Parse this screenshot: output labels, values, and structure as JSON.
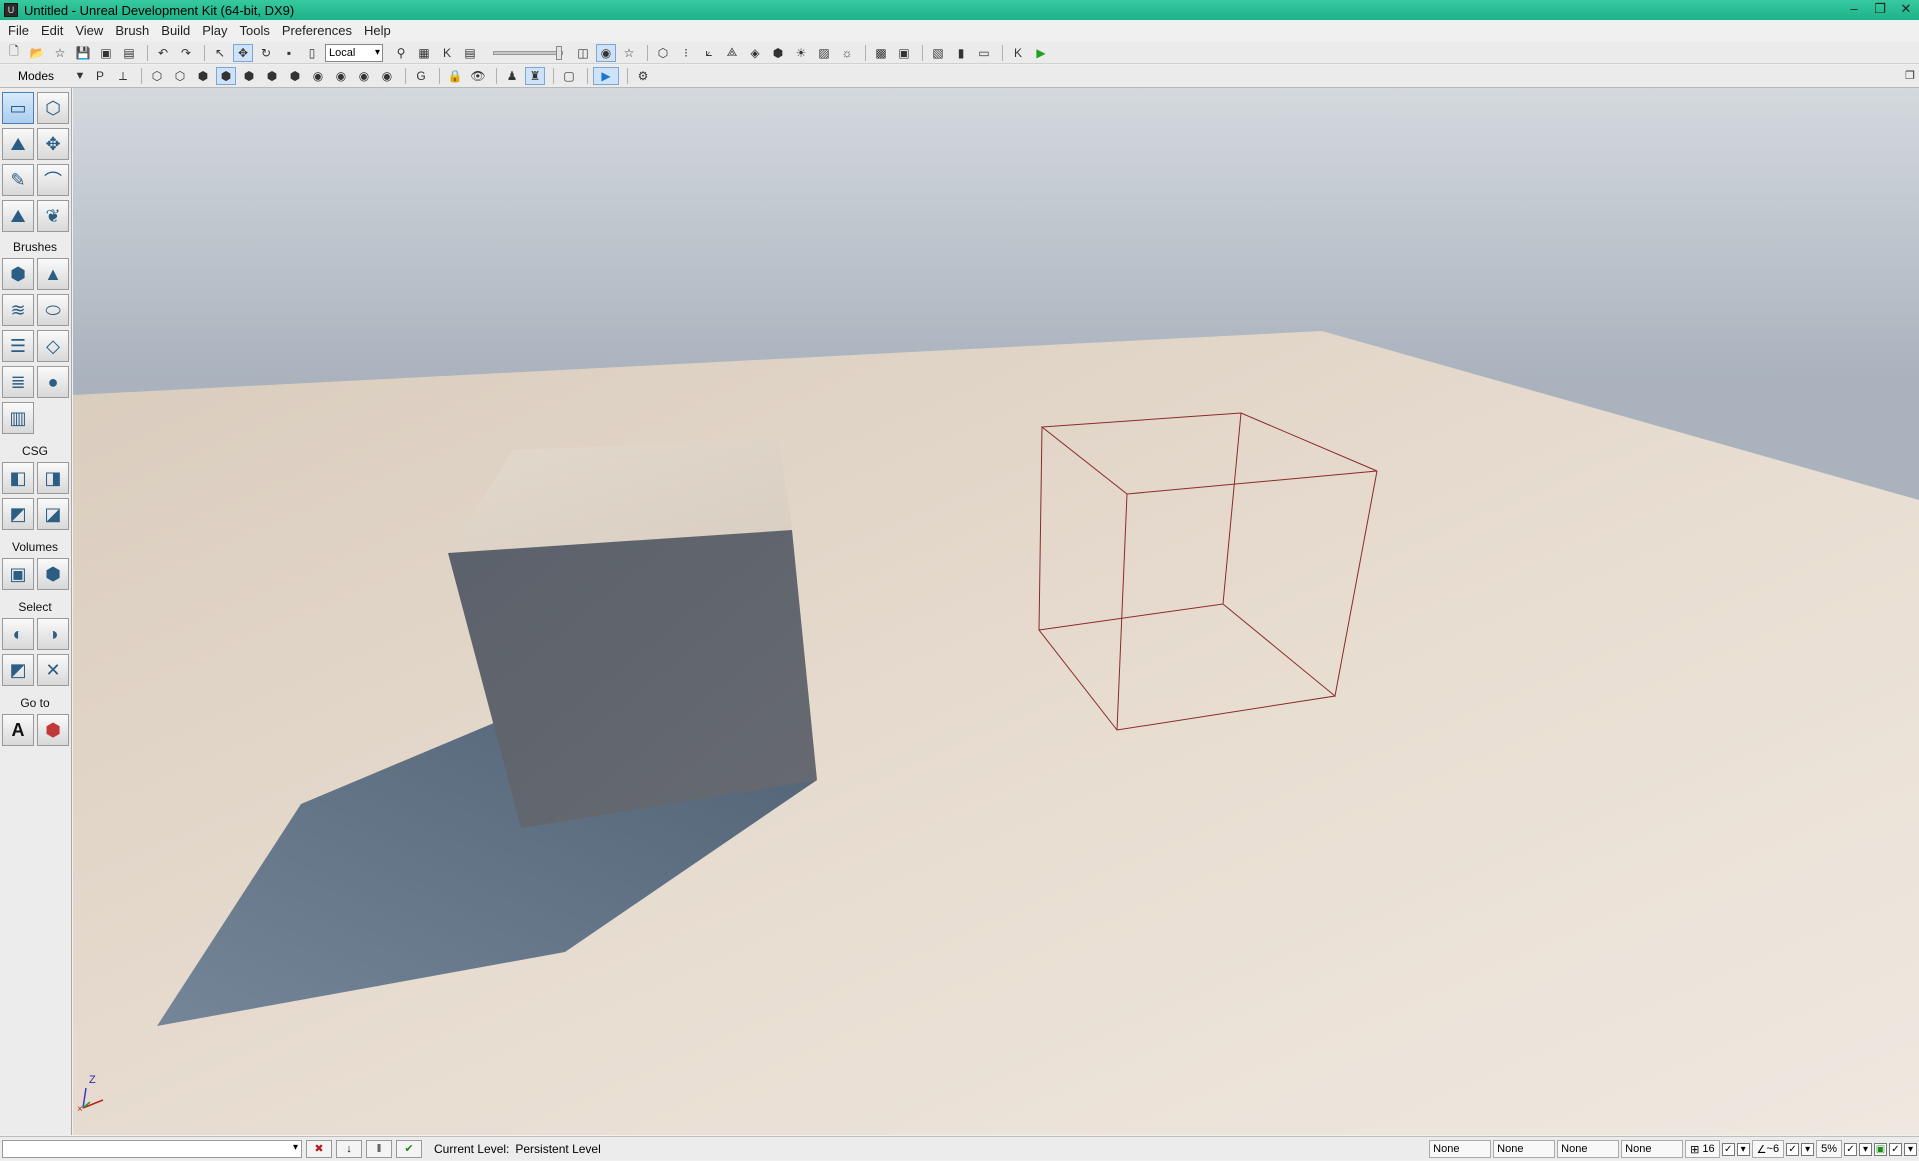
{
  "window": {
    "title": "Untitled - Unreal Development Kit (64-bit, DX9)"
  },
  "menu": [
    "File",
    "Edit",
    "View",
    "Brush",
    "Build",
    "Play",
    "Tools",
    "Preferences",
    "Help"
  ],
  "toolbar": {
    "coordinate_system": "Local"
  },
  "modes_panel": {
    "title": "Modes",
    "sections": {
      "brushes": "Brushes",
      "csg": "CSG",
      "volumes": "Volumes",
      "select": "Select",
      "goto": "Go to"
    }
  },
  "viewport": {
    "axis_label": "Z",
    "colors": {
      "sky_top": "#d4d9de",
      "sky_bottom": "#a9b2bd",
      "floor": "#e0d4c6",
      "cube": "#5b616b",
      "shadow": "#54677b",
      "builder_brush": "#8b2a2a"
    }
  },
  "statusbar": {
    "current_level_label": "Current Level:",
    "current_level_value": "Persistent Level",
    "fields": [
      "None",
      "None",
      "None",
      "None"
    ],
    "grid_size": "16",
    "rotation_snap": "~6",
    "scale_snap": "5%"
  }
}
